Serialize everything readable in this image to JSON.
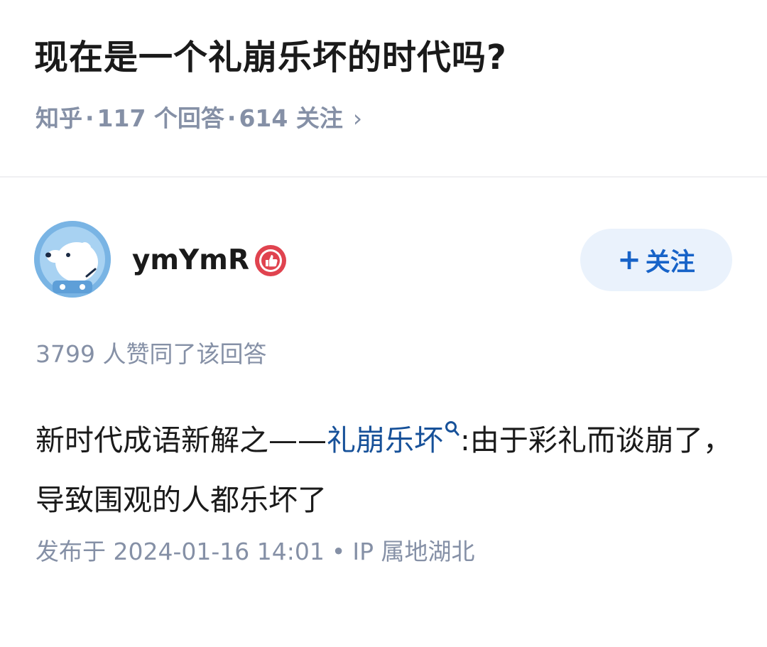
{
  "question": {
    "title": "现在是一个礼崩乐坏的时代吗?",
    "source": "知乎",
    "answers_count": "117 个回答",
    "followers_count": "614 关注"
  },
  "author": {
    "name": "ymYmR",
    "follow_label": "关注"
  },
  "answer": {
    "votes_text": "3799 人赞同了该回答",
    "content_prefix": "新时代成语新解之——",
    "content_keyword": "礼崩乐坏",
    "content_suffix": ":由于彩礼而谈崩了，导致围观的人都乐坏了",
    "published_date": "发布于 2024-01-16 14:01",
    "ip_location": "IP 属地湖北"
  },
  "icons": {
    "meta_chevron": "chevron-right-icon",
    "badge": "thumbs-up-badge-icon",
    "plus": "plus-icon",
    "keyword_search": "search-icon"
  },
  "colors": {
    "title": "#1a1a1a",
    "meta_gray": "#8590a6",
    "link_blue": "#175199",
    "follow_bg": "#eaf2fc",
    "follow_text": "#1763c8",
    "badge_red": "#e0434f"
  }
}
